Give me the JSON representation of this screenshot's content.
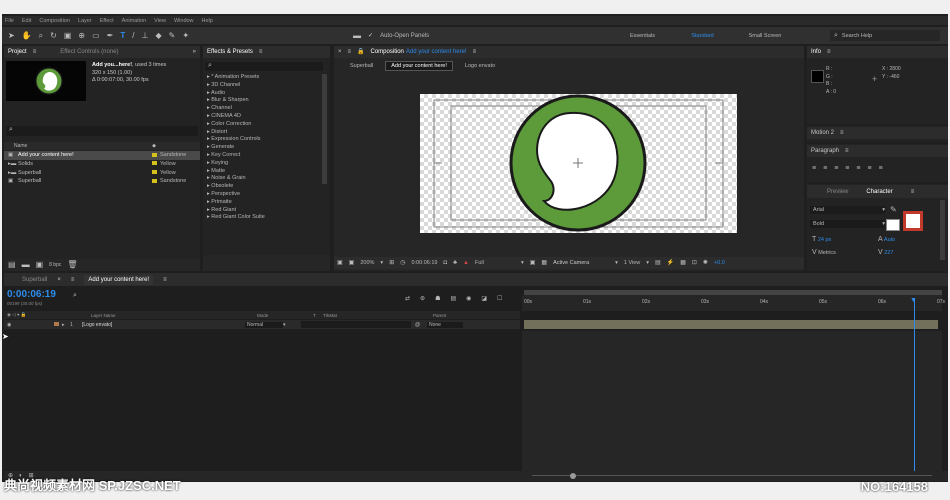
{
  "menu": [
    "File",
    "Edit",
    "Composition",
    "Layer",
    "Effect",
    "Animation",
    "View",
    "Window",
    "Help"
  ],
  "toolbar": {
    "auto_open": "Auto-Open Panels",
    "workspaces": [
      "Essentials",
      "Standard",
      "Small Screen"
    ],
    "search_help": "Search Help"
  },
  "project": {
    "tab": "Project",
    "effect_tab": "Effect Controls (none)",
    "item_name": "Add you...here!",
    "used": ", used 3 times",
    "dims": "320 x 150 (1.00)",
    "duration": "Δ 0:00:07:00, 30.00 fps",
    "col_name": "Name",
    "items": [
      {
        "name": "Add your content here!",
        "label": "Sandstone"
      },
      {
        "name": "Solids",
        "label": "Yellow"
      },
      {
        "name": "Superball",
        "label": "Yellow"
      },
      {
        "name": "Superball",
        "label": "Sandstone"
      }
    ],
    "bpc": "8 bpc"
  },
  "effects": {
    "tab": "Effects & Presets",
    "list": [
      "* Animation Presets",
      "3D Channel",
      "Audio",
      "Blur & Sharpen",
      "Channel",
      "CINEMA 4D",
      "Color Correction",
      "Distort",
      "Expression Controls",
      "Generate",
      "Key Correct",
      "Keying",
      "Matte",
      "Noise & Grain",
      "Obsolete",
      "Perspective",
      "Primatte",
      "Red Giant",
      "Red Giant Color Suite"
    ]
  },
  "composition": {
    "tab": "Composition",
    "comp_name": "Add your content here!",
    "crumbs": [
      "Superball",
      "Add your content here!",
      "Logo envato"
    ],
    "zoom": "200%",
    "time": "0:00:06:19",
    "res": "Full",
    "camera": "Active Camera",
    "view": "1 View",
    "exposure": "+0.0"
  },
  "info": {
    "tab": "Info",
    "r": "R :",
    "g": "G :",
    "b": "B :",
    "a": "A : 0",
    "x": "X : 2800",
    "y": "Y : -460"
  },
  "motion": {
    "tab": "Motion 2"
  },
  "paragraph": {
    "tab": "Paragraph"
  },
  "character": {
    "preview_tab": "Preview",
    "tab": "Character",
    "font": "Arial",
    "style": "Bold",
    "size": "24 px",
    "leading": "Auto",
    "kerning": "Metrics",
    "tracking": "227"
  },
  "timeline": {
    "tabs": [
      "Superball",
      "Add your content here!"
    ],
    "time": "0:00:06:19",
    "frames": "00199 (30.00 fps)",
    "cols": [
      "Layer Name",
      "Mode",
      "T",
      "TrkMat",
      "Parent"
    ],
    "layer": {
      "num": "1",
      "name": "[Logo envato]",
      "mode": "Normal",
      "parent": "None"
    },
    "ruler": [
      "00s",
      "01s",
      "02s",
      "03s",
      "04s",
      "05s",
      "06s",
      "07s"
    ]
  },
  "watermark": {
    "left": "典尚视频素材网 SP.JZSC.NET",
    "right": "NO:164158"
  },
  "colors": {
    "accent": "#2d8ceb",
    "logo_green": "#5c9a3a",
    "label_yellow": "#d4c21a"
  }
}
